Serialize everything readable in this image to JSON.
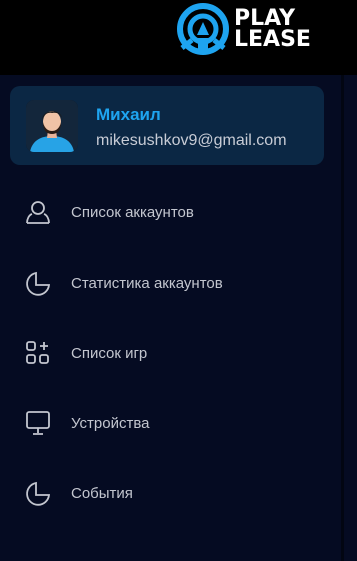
{
  "brand": {
    "logo_line1": "PLAY",
    "logo_line2": "LEASE",
    "accent_color": "#1ea4f0",
    "icon": "playlease-logo-icon"
  },
  "profile": {
    "name": "Михаил",
    "email": "mikesushkov9@gmail.com",
    "avatar_icon": "user-avatar"
  },
  "sidebar": {
    "items": [
      {
        "label": "Список аккаунтов",
        "icon": "user-icon"
      },
      {
        "label": "Статистика аккаунтов",
        "icon": "pie-chart-icon"
      },
      {
        "label": "Список игр",
        "icon": "grid-plus-icon"
      },
      {
        "label": "Устройства",
        "icon": "monitor-icon"
      },
      {
        "label": "События",
        "icon": "pie-chart-icon"
      }
    ]
  }
}
